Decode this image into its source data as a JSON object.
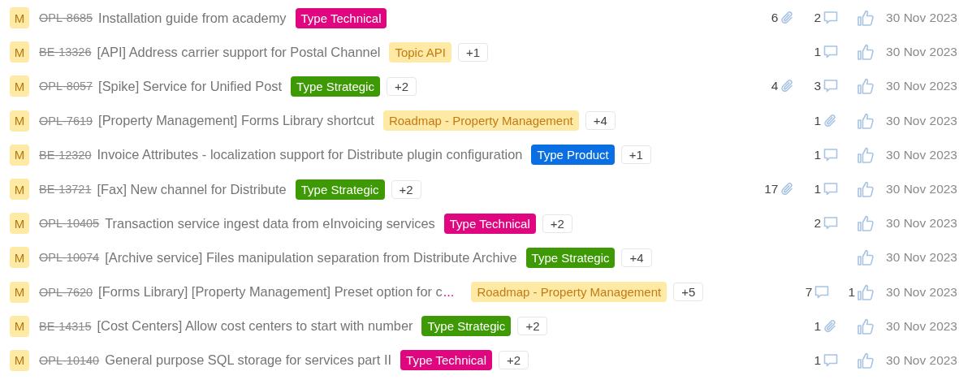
{
  "issues": [
    {
      "avatar": "M",
      "key": "OPL-8685",
      "title": "Installation guide from academy",
      "tags": [
        {
          "label": "Type Technical",
          "kind": "solid",
          "color": "#e0067f"
        }
      ],
      "attachments": "6",
      "comments": "2",
      "date": "30 Nov 2023"
    },
    {
      "avatar": "M",
      "key": "BE-13326",
      "title": "[API] Address carrier support for Postal Channel",
      "tags": [
        {
          "label": "Topic API",
          "kind": "soft",
          "color": "#feeaa5"
        }
      ],
      "more_tags": "+1",
      "comments": "1",
      "date": "30 Nov 2023"
    },
    {
      "avatar": "M",
      "key": "OPL-8057",
      "title": "[Spike] Service for Unified Post",
      "tags": [
        {
          "label": "Type Strategic",
          "kind": "solid",
          "color": "#3e9a04"
        }
      ],
      "more_tags": "+2",
      "attachments": "4",
      "comments": "3",
      "date": "30 Nov 2023"
    },
    {
      "avatar": "M",
      "key": "OPL-7619",
      "title": "[Property Management] Forms Library shortcut",
      "tags": [
        {
          "label": "Roadmap - Property Management",
          "kind": "soft",
          "color": "#feeaa5"
        }
      ],
      "more_tags": "+4",
      "attachments": "1",
      "date": "30 Nov 2023"
    },
    {
      "avatar": "M",
      "key": "BE-12320",
      "title": "Invoice Attributes - localization support for Distribute plugin configuration",
      "tags": [
        {
          "label": "Type Product",
          "kind": "solid",
          "color": "#0a6fe3"
        }
      ],
      "more_tags": "+1",
      "comments": "1",
      "date": "30 Nov 2023"
    },
    {
      "avatar": "M",
      "key": "BE-13721",
      "title": "[Fax] New channel for Distribute",
      "tags": [
        {
          "label": "Type Strategic",
          "kind": "solid",
          "color": "#3e9a04"
        }
      ],
      "more_tags": "+2",
      "attachments": "17",
      "comments": "1",
      "date": "30 Nov 2023"
    },
    {
      "avatar": "M",
      "key": "OPL-10405",
      "title": "Transaction service ingest data from eInvoicing services",
      "tags": [
        {
          "label": "Type Technical",
          "kind": "solid",
          "color": "#e0067f"
        }
      ],
      "more_tags": "+2",
      "comments": "2",
      "date": "30 Nov 2023"
    },
    {
      "avatar": "M",
      "key": "OPL-10074",
      "title": "[Archive service] Files manipulation separation from Distribute Archive",
      "tags": [
        {
          "label": "Type Strategic",
          "kind": "solid",
          "color": "#3e9a04"
        }
      ],
      "more_tags": "+4",
      "date": "30 Nov 2023"
    },
    {
      "avatar": "M",
      "key": "OPL-7620",
      "title": "[Forms Library] [Property Management] Preset option for c",
      "ellipsis": "...",
      "tags": [
        {
          "label": "Roadmap - Property Management",
          "kind": "soft",
          "color": "#feeaa5"
        }
      ],
      "more_tags": "+5",
      "comments": "7",
      "likes": "1",
      "date": "30 Nov 2023"
    },
    {
      "avatar": "M",
      "key": "BE-14315",
      "title": "[Cost Centers] Allow cost centers to start with number",
      "tags": [
        {
          "label": "Type Strategic",
          "kind": "solid",
          "color": "#3e9a04"
        }
      ],
      "more_tags": "+2",
      "attachments": "1",
      "date": "30 Nov 2023"
    },
    {
      "avatar": "M",
      "key": "OPL-10140",
      "title": "General purpose SQL storage for services part II",
      "tags": [
        {
          "label": "Type Technical",
          "kind": "solid",
          "color": "#e0067f"
        }
      ],
      "more_tags": "+2",
      "comments": "1",
      "date": "30 Nov 2023"
    }
  ]
}
